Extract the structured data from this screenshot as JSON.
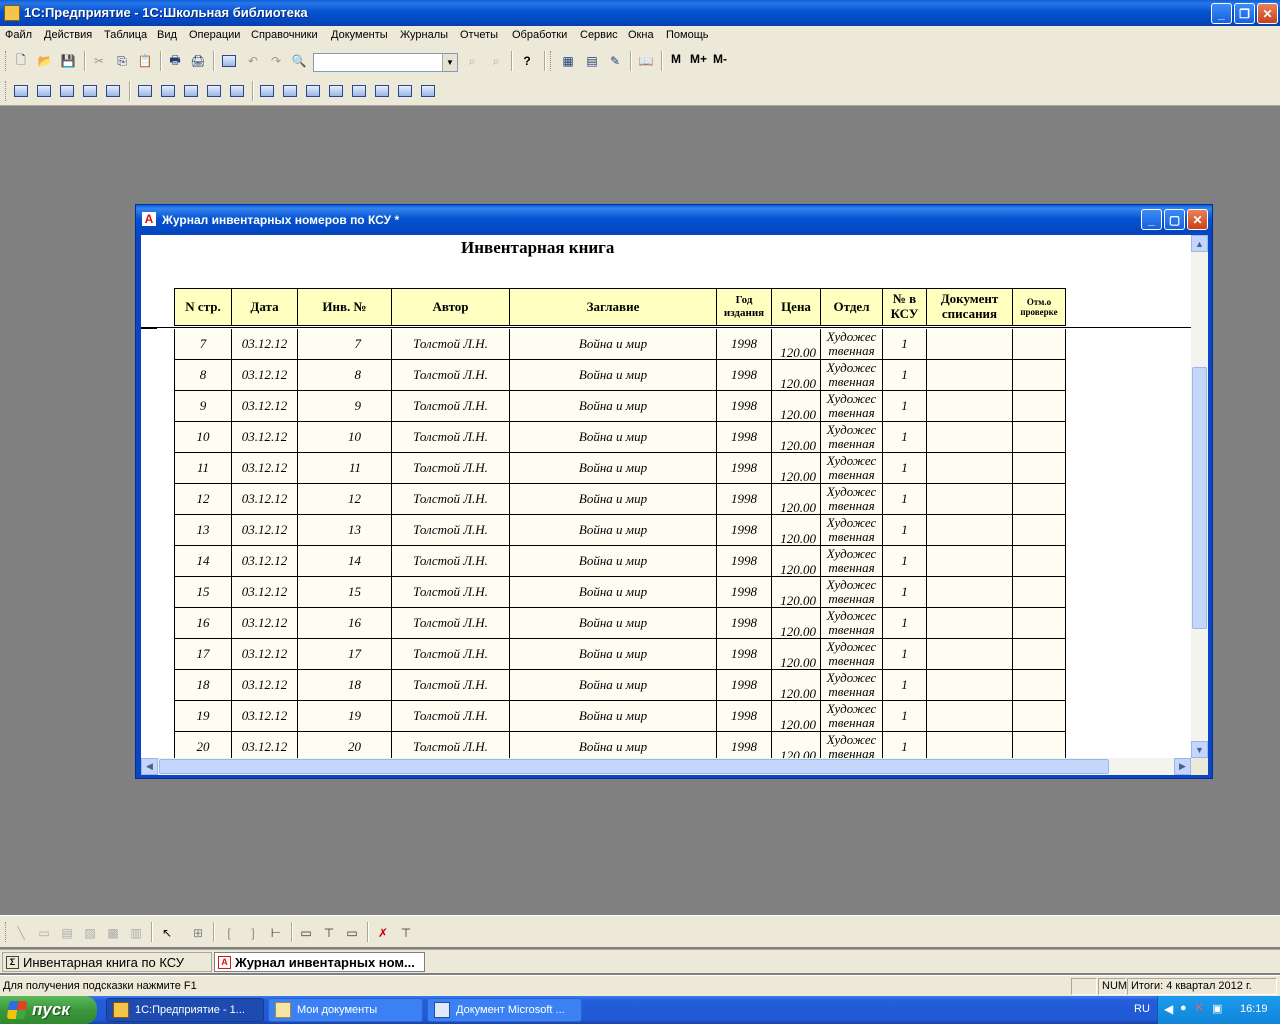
{
  "app": {
    "title": "1С:Предприятие - 1С:Школьная библиотека"
  },
  "menu": [
    "Файл",
    "Действия",
    "Таблица",
    "Вид",
    "Операции",
    "Справочники",
    "Документы",
    "Журналы",
    "Отчеты",
    "Обработки",
    "Сервис",
    "Окна",
    "Помощь"
  ],
  "toolbar": {
    "m_labels": [
      "M",
      "M+",
      "M-"
    ],
    "search_value": ""
  },
  "report_window": {
    "title": "Журнал инвентарных номеров по КСУ  *",
    "report_title": "Инвентарная книга",
    "columns": [
      "N стр.",
      "Дата",
      "Инв. №",
      "Автор",
      "Заглавие",
      "Год издания",
      "Цена",
      "Отдел",
      "№ в КСУ",
      "Документ списания",
      "Отм.о проверке"
    ],
    "rows": [
      [
        "7",
        "03.12.12",
        "7",
        "Толстой Л.Н.",
        "Война и мир",
        "1998",
        "120.00",
        "Художес твенная",
        "1",
        "",
        ""
      ],
      [
        "8",
        "03.12.12",
        "8",
        "Толстой Л.Н.",
        "Война и мир",
        "1998",
        "120.00",
        "Художес твенная",
        "1",
        "",
        ""
      ],
      [
        "9",
        "03.12.12",
        "9",
        "Толстой Л.Н.",
        "Война и мир",
        "1998",
        "120.00",
        "Художес твенная",
        "1",
        "",
        ""
      ],
      [
        "10",
        "03.12.12",
        "10",
        "Толстой Л.Н.",
        "Война и мир",
        "1998",
        "120.00",
        "Художес твенная",
        "1",
        "",
        ""
      ],
      [
        "11",
        "03.12.12",
        "11",
        "Толстой Л.Н.",
        "Война и мир",
        "1998",
        "120.00",
        "Художес твенная",
        "1",
        "",
        ""
      ],
      [
        "12",
        "03.12.12",
        "12",
        "Толстой Л.Н.",
        "Война и мир",
        "1998",
        "120.00",
        "Художес твенная",
        "1",
        "",
        ""
      ],
      [
        "13",
        "03.12.12",
        "13",
        "Толстой Л.Н.",
        "Война и мир",
        "1998",
        "120.00",
        "Художес твенная",
        "1",
        "",
        ""
      ],
      [
        "14",
        "03.12.12",
        "14",
        "Толстой Л.Н.",
        "Война и мир",
        "1998",
        "120.00",
        "Художес твенная",
        "1",
        "",
        ""
      ],
      [
        "15",
        "03.12.12",
        "15",
        "Толстой Л.Н.",
        "Война и мир",
        "1998",
        "120.00",
        "Художес твенная",
        "1",
        "",
        ""
      ],
      [
        "16",
        "03.12.12",
        "16",
        "Толстой Л.Н.",
        "Война и мир",
        "1998",
        "120.00",
        "Художес твенная",
        "1",
        "",
        ""
      ],
      [
        "17",
        "03.12.12",
        "17",
        "Толстой Л.Н.",
        "Война и мир",
        "1998",
        "120.00",
        "Художес твенная",
        "1",
        "",
        ""
      ],
      [
        "18",
        "03.12.12",
        "18",
        "Толстой Л.Н.",
        "Война и мир",
        "1998",
        "120.00",
        "Художес твенная",
        "1",
        "",
        ""
      ],
      [
        "19",
        "03.12.12",
        "19",
        "Толстой Л.Н.",
        "Война и мир",
        "1998",
        "120.00",
        "Художес твенная",
        "1",
        "",
        ""
      ],
      [
        "20",
        "03.12.12",
        "20",
        "Толстой Л.Н.",
        "Война и мир",
        "1998",
        "120.00",
        "Художес твенная",
        "1",
        "",
        ""
      ]
    ]
  },
  "window_tabs": [
    {
      "label": "Инвентарная книга по КСУ",
      "active": false
    },
    {
      "label": "Журнал инвентарных ном...",
      "active": true
    }
  ],
  "status": {
    "hint": "Для получения подсказки нажмите F1",
    "num": "NUM",
    "period": "Итоги: 4 квартал 2012 г."
  },
  "taskbar": {
    "start_label": "пуск",
    "tasks": [
      {
        "label": "1С:Предприятие - 1...",
        "active": true
      },
      {
        "label": "Мои документы",
        "active": false
      },
      {
        "label": "Документ Microsoft ...",
        "active": false
      }
    ],
    "language": "RU",
    "clock": "16:19"
  },
  "colors": {
    "xp_blue": "#0552d1",
    "header_fill": "#ffffc0",
    "cell_fill": "#fffdf2",
    "desktop_gray": "#808080"
  }
}
